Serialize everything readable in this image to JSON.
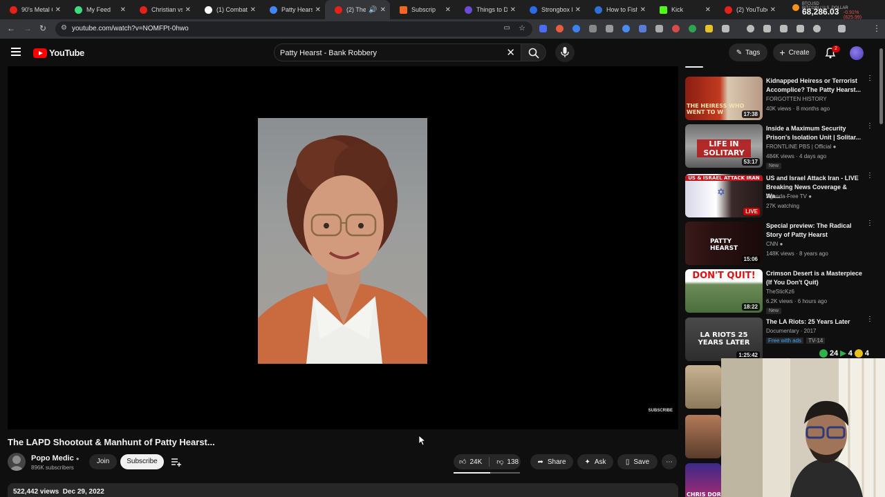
{
  "browser": {
    "tabs": [
      {
        "title": "90's Metal Cl",
        "color": "#e62117"
      },
      {
        "title": "My Feed",
        "color": "#3ddc84"
      },
      {
        "title": "Christian vs J",
        "color": "#e62117"
      },
      {
        "title": "(1) Combat A",
        "color": "#ffffff"
      },
      {
        "title": "Patty Hearst",
        "color": "#4285f4"
      },
      {
        "title": "(2) The L",
        "color": "#e62117"
      },
      {
        "title": "Subscrip",
        "color": "#f26522"
      },
      {
        "title": "Things to Do",
        "color": "#6b4bd6"
      },
      {
        "title": "Strongbox P",
        "color": "#2b6be6"
      },
      {
        "title": "How to Fish",
        "color": "#2e6fd8"
      },
      {
        "title": "Kick",
        "color": "#53fc18"
      },
      {
        "title": "(2) YouTube",
        "color": "#e62117"
      }
    ],
    "ticker": {
      "symbol": "BTCUSD",
      "pair": "BITCOIN / U.S. DOLLAR",
      "price": "68,286.03",
      "change": "-0.91% (625.99)"
    },
    "url": "youtube.com/watch?v=NOMFPt-0hwo"
  },
  "youtube": {
    "logo_text": "YouTube",
    "search_query": "Patty Hearst - Bank Robbery",
    "tags_label": "Tags",
    "create_label": "Create",
    "notification_count": "2"
  },
  "video": {
    "watermark": "SUBSCRIBE",
    "title": "The LAPD Shootout & Manhunt of Patty Hearst...",
    "channel": "Popo Medic",
    "subscribers": "896K subscribers",
    "join_label": "Join",
    "subscribe_label": "Subscribe",
    "likes": "24K",
    "dislikes": "138",
    "like_ratio": 0.55,
    "share_label": "Share",
    "ask_label": "Ask",
    "save_label": "Save",
    "views": "522,442 views",
    "date": "Dec 29, 2022"
  },
  "recommendations": [
    {
      "title": "Kidnapped Heiress or Terrorist Accomplice? The Patty Hearst...",
      "channel": "FORGOTTEN HISTORY",
      "meta": "40K views · 8 months ago",
      "duration": "17:38",
      "thumb_text": "THE HEIRESS WHO WENT TO W"
    },
    {
      "title": "Inside a Maximum Security Prison's Isolation Unit | Solitar...",
      "channel": "FRONTLINE PBS | Official",
      "meta": "484K views · 4 days ago",
      "duration": "53:17",
      "badge": "New",
      "thumb_text": "LIFE IN SOLITARY"
    },
    {
      "title": "US and Israel Attack Iran - LIVE Breaking News Coverage & Wa...",
      "channel": "Agenda-Free TV",
      "meta": "27K watching",
      "duration": "LIVE",
      "thumb_text": "US & ISRAEL ATTACK IRAN"
    },
    {
      "title": "Special preview: The Radical Story of Patty Hearst",
      "channel": "CNN",
      "meta": "148K views · 8 years ago",
      "duration": "15:06",
      "thumb_text": "PATTY HEARST"
    },
    {
      "title": "Crimson Desert is a Masterpiece (If You Don't Quit)",
      "channel": "TheSticKz6",
      "meta": "6.2K views · 6 hours ago",
      "duration": "18:22",
      "badge": "New",
      "thumb_text": "DON'T QUIT!"
    },
    {
      "title": "The LA Riots: 25 Years Later",
      "channel": "Documentary · 2017",
      "meta_free": "Free with ads",
      "rating": "TV-14",
      "duration": "1:25:42",
      "thumb_text": "LA RIOTS 25 YEARS LATER"
    }
  ],
  "extra_thumb_text": "CHRIS DOR",
  "stream_overlay": {
    "counts": [
      "24",
      "4",
      "4"
    ]
  }
}
